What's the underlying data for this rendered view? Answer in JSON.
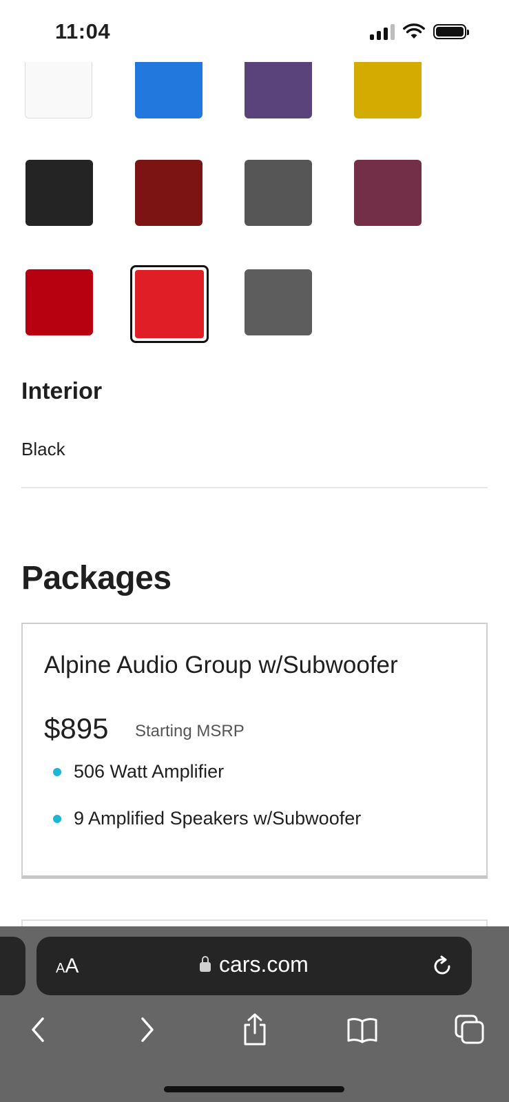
{
  "status_bar": {
    "time": "11:04"
  },
  "color_swatches": [
    {
      "color": "#f9f9f9"
    },
    {
      "color": "#2378dd"
    },
    {
      "color": "#5a427a"
    },
    {
      "color": "#d3ab01"
    },
    {
      "color": "#242424"
    },
    {
      "color": "#7c1414"
    },
    {
      "color": "#565656"
    },
    {
      "color": "#722f47"
    },
    {
      "color": "#b70010"
    },
    {
      "color": "#e01e25",
      "selected": true
    },
    {
      "color": "#5d5d5d"
    }
  ],
  "interior": {
    "heading": "Interior",
    "value": "Black"
  },
  "packages": {
    "heading": "Packages",
    "items": [
      {
        "title": "Alpine Audio Group w/Subwoofer",
        "price": "$895",
        "price_label": "Starting MSRP",
        "features": [
          "506 Watt Amplifier",
          "9 Amplified Speakers w/Subwoofer"
        ]
      }
    ]
  },
  "browser": {
    "text_size_label_small": "A",
    "text_size_label_large": "A",
    "url": "cars.com",
    "icons": [
      "lock-icon",
      "reload-icon",
      "back-icon",
      "forward-icon",
      "share-icon",
      "bookmarks-icon",
      "tabs-icon"
    ]
  }
}
